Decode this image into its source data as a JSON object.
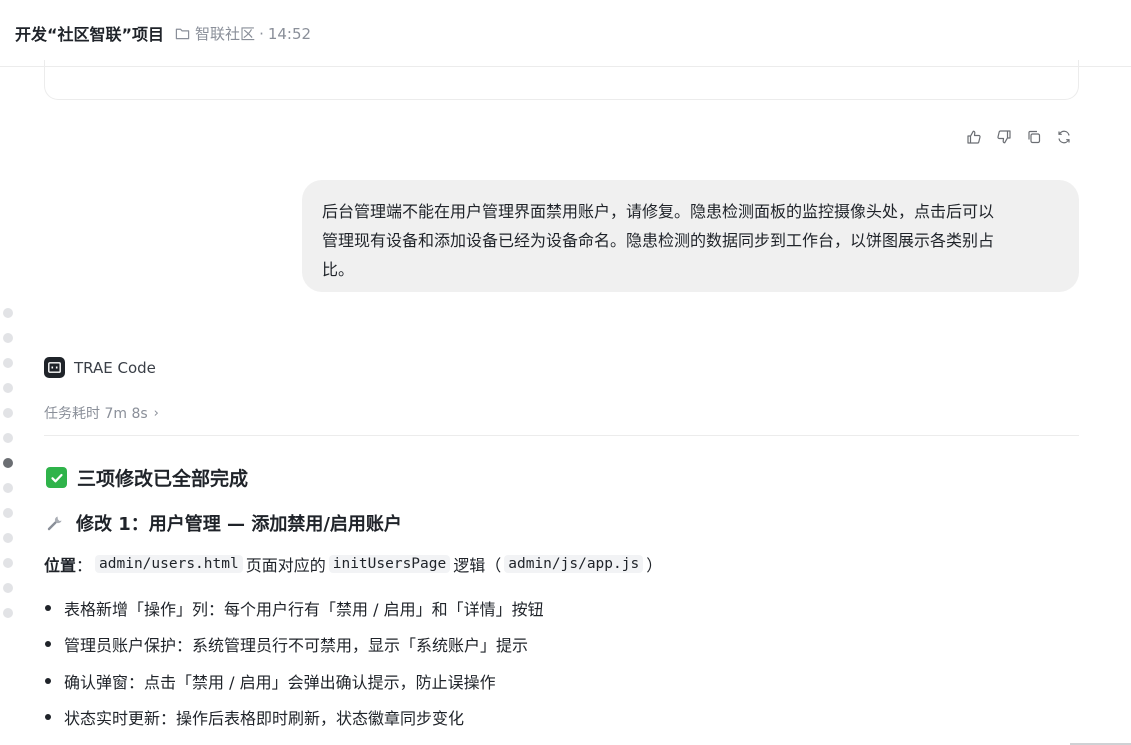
{
  "header": {
    "title": "开发“社区智联”项目",
    "folder_icon": "folder-icon",
    "workspace": "智联社区",
    "separator": "·",
    "time": "14:52"
  },
  "message_actions": [
    {
      "name": "thumbs-up-icon"
    },
    {
      "name": "thumbs-down-icon"
    },
    {
      "name": "copy-icon"
    },
    {
      "name": "refresh-icon"
    }
  ],
  "user_message": {
    "lines": [
      "后台管理端不能在用户管理界面禁用账户，请修复。隐患检测面板的监控摄像头处，点击后可以",
      "管理现有设备和添加设备已经为设备命名。隐患检测的数据同步到工作台，以饼图展示各类别占",
      "比。"
    ]
  },
  "agent": {
    "name": "TRAE Code",
    "duration_label": "任务耗时 7m 8s",
    "chevron": "›"
  },
  "response": {
    "heading": "三项修改已全部完成",
    "section_title": "修改 1：用户管理 — 添加禁用/启用账户",
    "location_label": "位置",
    "location_colon": "：",
    "code_file": "admin/users.html",
    "text_page": "页面对应的",
    "code_fn": "initUsersPage",
    "text_logic": "逻辑（",
    "code_js": "admin/js/app.js",
    "text_close": "）",
    "bullets": [
      "表格新增「操作」列：每个用户行有「禁用 / 启用」和「详情」按钮",
      "管理员账户保护：系统管理员行不可禁用，显示「系统账户」提示",
      "确认弹窗：点击「禁用 / 启用」会弹出确认提示，防止误操作",
      "状态实时更新：操作后表格即时刷新，状态徽章同步变化"
    ]
  },
  "colors": {
    "accent_green": "#2fb34a",
    "bubble_bg": "#f0f0f0",
    "muted_text": "#8a8f99"
  }
}
